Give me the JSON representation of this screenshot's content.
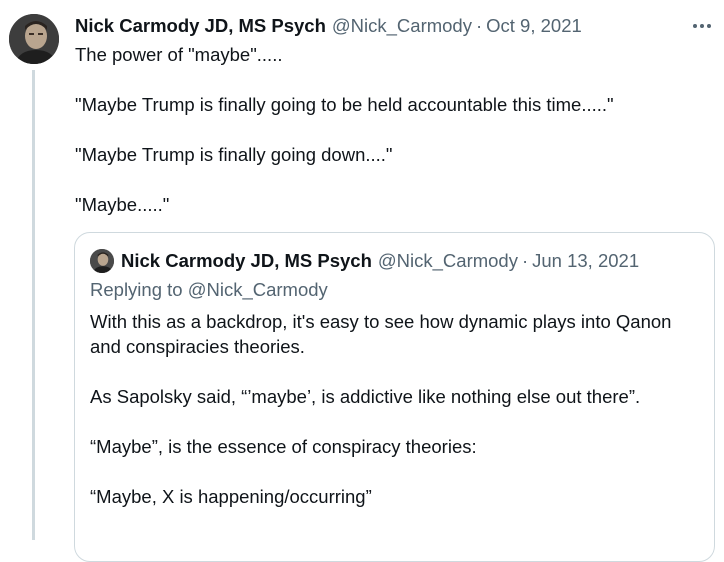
{
  "tweet": {
    "author_name": "Nick Carmody JD, MS Psych",
    "handle": "@Nick_Carmody",
    "separator": "·",
    "date": "Oct 9, 2021",
    "paragraphs": [
      "The power of \"maybe\".....",
      "\"Maybe Trump is finally going to be held accountable this time.....\"",
      "\"Maybe Trump is finally going down....\"",
      "\"Maybe.....\""
    ],
    "more_icon": "more-horizontal-icon"
  },
  "quoted_tweet": {
    "author_name": "Nick Carmody JD, MS Psych",
    "handle": "@Nick_Carmody",
    "separator": "·",
    "date": "Jun 13, 2021",
    "replying_to": "Replying to @Nick_Carmody",
    "paragraphs": [
      "With this as a backdrop, it's easy to see how dynamic plays into Qanon and conspiracies theories.",
      "As Sapolsky said, “’maybe’, is addictive like nothing else out there”.",
      "“Maybe”, is the essence of conspiracy theories:",
      "“Maybe, X is happening/occurring”"
    ]
  },
  "colors": {
    "text": "#0f1419",
    "secondary": "#536471",
    "border": "#cfd9de"
  }
}
